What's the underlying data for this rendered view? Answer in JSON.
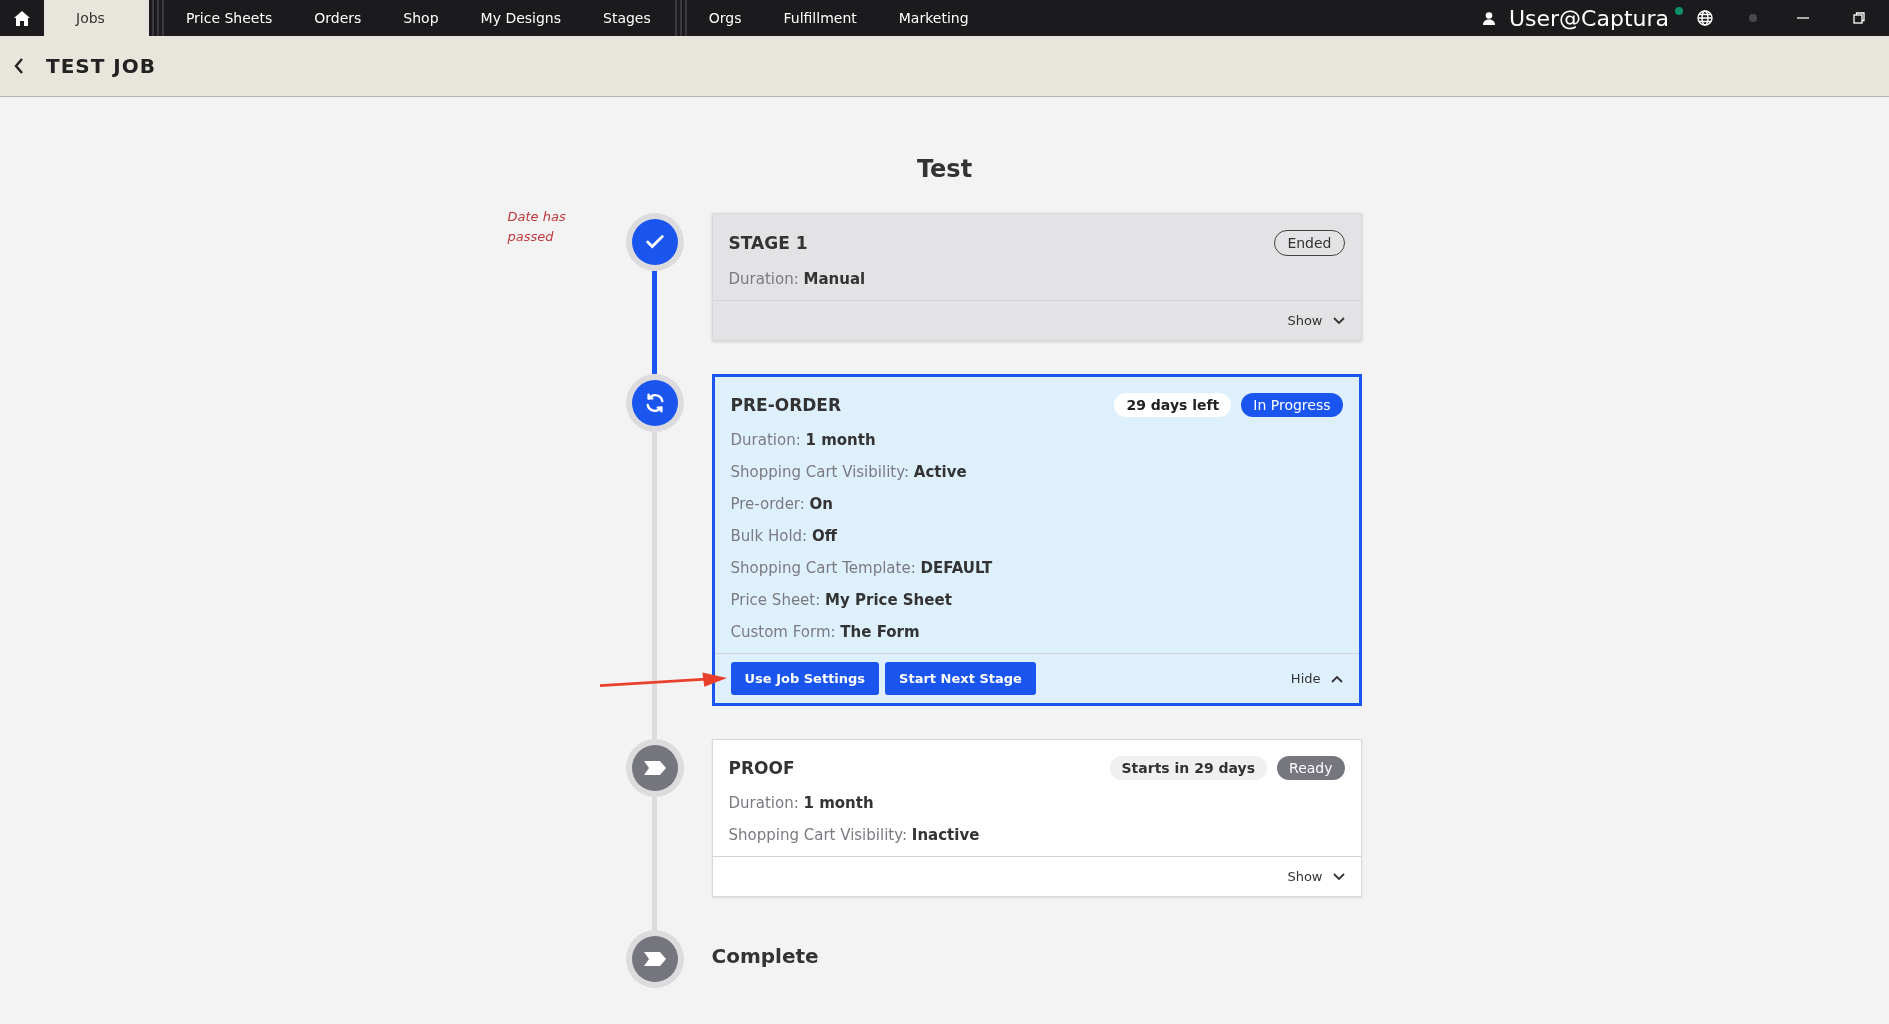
{
  "nav": {
    "groups": [
      [
        {
          "label": "Jobs",
          "selected": true
        }
      ],
      [
        {
          "label": "Price Sheets",
          "selected": false
        },
        {
          "label": "Orders",
          "selected": false
        },
        {
          "label": "Shop",
          "selected": false
        },
        {
          "label": "My Designs",
          "selected": false
        },
        {
          "label": "Stages",
          "selected": false
        }
      ],
      [
        {
          "label": "Orgs",
          "selected": false
        },
        {
          "label": "Fulfillment",
          "selected": false
        },
        {
          "label": "Marketing",
          "selected": false
        }
      ]
    ],
    "user": "User@Captura"
  },
  "header": {
    "title": "TEST JOB"
  },
  "job_title": "Test",
  "stages": [
    {
      "kind": "done",
      "note": "Date has passed",
      "title": "STAGE 1",
      "badges": [
        {
          "text": "Ended",
          "kind": "outline"
        }
      ],
      "details": [
        {
          "label": "Duration:",
          "value": "Manual"
        }
      ],
      "toggle": {
        "label": "Show",
        "expanded": false
      }
    },
    {
      "kind": "active",
      "title": "PRE-ORDER",
      "badges": [
        {
          "text": "29 days left",
          "kind": "plain"
        },
        {
          "text": "In Progress",
          "kind": "primary"
        }
      ],
      "details": [
        {
          "label": "Duration:",
          "value": "1 month"
        },
        {
          "label": "Shopping Cart Visibility:",
          "value": "Active"
        },
        {
          "label": "Pre-order:",
          "value": "On"
        },
        {
          "label": "Bulk Hold:",
          "value": "Off"
        },
        {
          "label": "Shopping Cart Template:",
          "value": "DEFAULT"
        },
        {
          "label": "Price Sheet:",
          "value": "My Price Sheet"
        },
        {
          "label": "Custom Form:",
          "value": "The Form"
        }
      ],
      "toggle": {
        "label": "Hide",
        "expanded": true
      },
      "buttons": [
        "Use Job Settings",
        "Start Next Stage"
      ]
    },
    {
      "kind": "upcoming",
      "title": "PROOF",
      "badges": [
        {
          "text": "Starts in 29 days",
          "kind": "soft"
        },
        {
          "text": "Ready",
          "kind": "muted"
        }
      ],
      "details": [
        {
          "label": "Duration:",
          "value": "1 month"
        },
        {
          "label": "Shopping Cart Visibility:",
          "value": "Inactive"
        }
      ],
      "toggle": {
        "label": "Show",
        "expanded": false
      }
    },
    {
      "kind": "final",
      "title": "Complete"
    }
  ]
}
